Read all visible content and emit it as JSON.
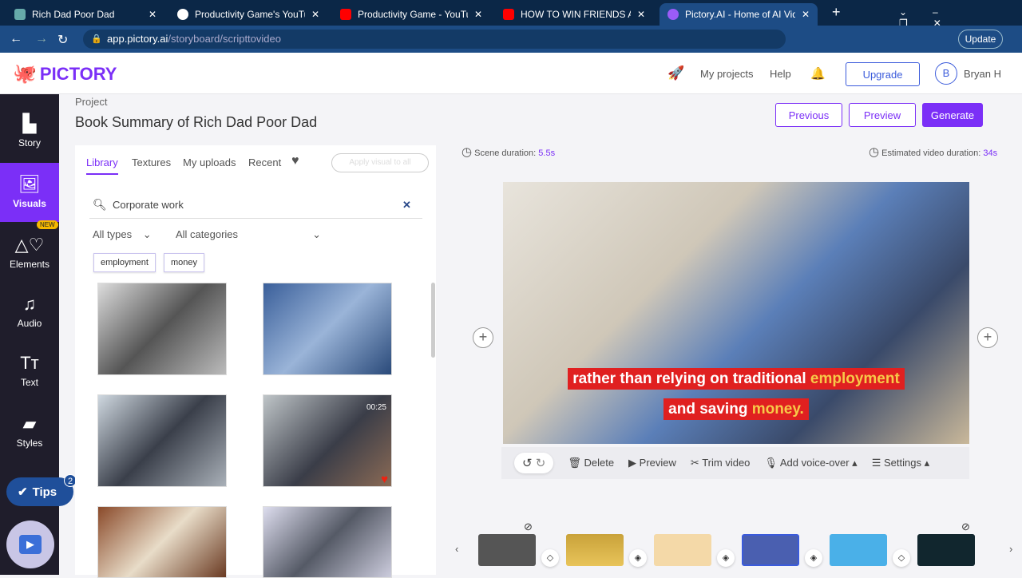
{
  "browser": {
    "tabs": [
      {
        "title": "Rich Dad Poor Dad",
        "icon": "chatgpt-icon"
      },
      {
        "title": "Productivity Game's YouTube",
        "icon": "globe-icon"
      },
      {
        "title": "Productivity Game - YouTube",
        "icon": "youtube-icon"
      },
      {
        "title": "HOW TO WIN FRIENDS AND",
        "icon": "youtube-icon"
      },
      {
        "title": "Pictory.AI - Home of AI Video",
        "icon": "pictory-icon",
        "active": true
      }
    ],
    "url_host": "app.pictory.ai",
    "url_path": "/storyboard/scripttovideo",
    "update_label": "Update"
  },
  "header": {
    "logo": "PICTORY",
    "my_projects": "My projects",
    "help": "Help",
    "upgrade": "Upgrade",
    "avatar_initial": "B",
    "user": "Bryan H"
  },
  "sidebar": {
    "items": [
      {
        "label": "Story",
        "icon": "story-icon"
      },
      {
        "label": "Visuals",
        "icon": "image-icon",
        "active": true
      },
      {
        "label": "Elements",
        "icon": "elements-icon",
        "badge": "NEW"
      },
      {
        "label": "Audio",
        "icon": "music-icon"
      },
      {
        "label": "Text",
        "icon": "text-icon"
      },
      {
        "label": "Styles",
        "icon": "styles-icon"
      }
    ],
    "tips": "Tips",
    "tips_count": "2"
  },
  "project": {
    "label": "Project",
    "title": "Book Summary of Rich Dad Poor Dad",
    "previous": "Previous",
    "preview": "Preview",
    "generate": "Generate"
  },
  "library": {
    "tabs": [
      "Library",
      "Textures",
      "My uploads",
      "Recent"
    ],
    "apply_all": "Apply visual to all",
    "search_value": "Corporate work",
    "type_filter": "All types",
    "category_filter": "All categories",
    "tags": [
      "employment",
      "money"
    ],
    "thumb_duration": "00:25"
  },
  "scene": {
    "duration_label": "Scene duration:",
    "duration": "5.5s",
    "est_label": "Estimated video duration:",
    "est": "34s",
    "caption_line1": "rather than relying on traditional ",
    "caption_hi1": "employment",
    "caption_line2": "and saving ",
    "caption_hi2": "money."
  },
  "toolbar": {
    "delete": "Delete",
    "preview": "Preview",
    "trim": "Trim video",
    "voice": "Add voice-over",
    "settings": "Settings"
  },
  "colors": {
    "accent": "#7b2ff7",
    "caption_bg": "#e02020",
    "caption_highlight": "#f7c948"
  }
}
